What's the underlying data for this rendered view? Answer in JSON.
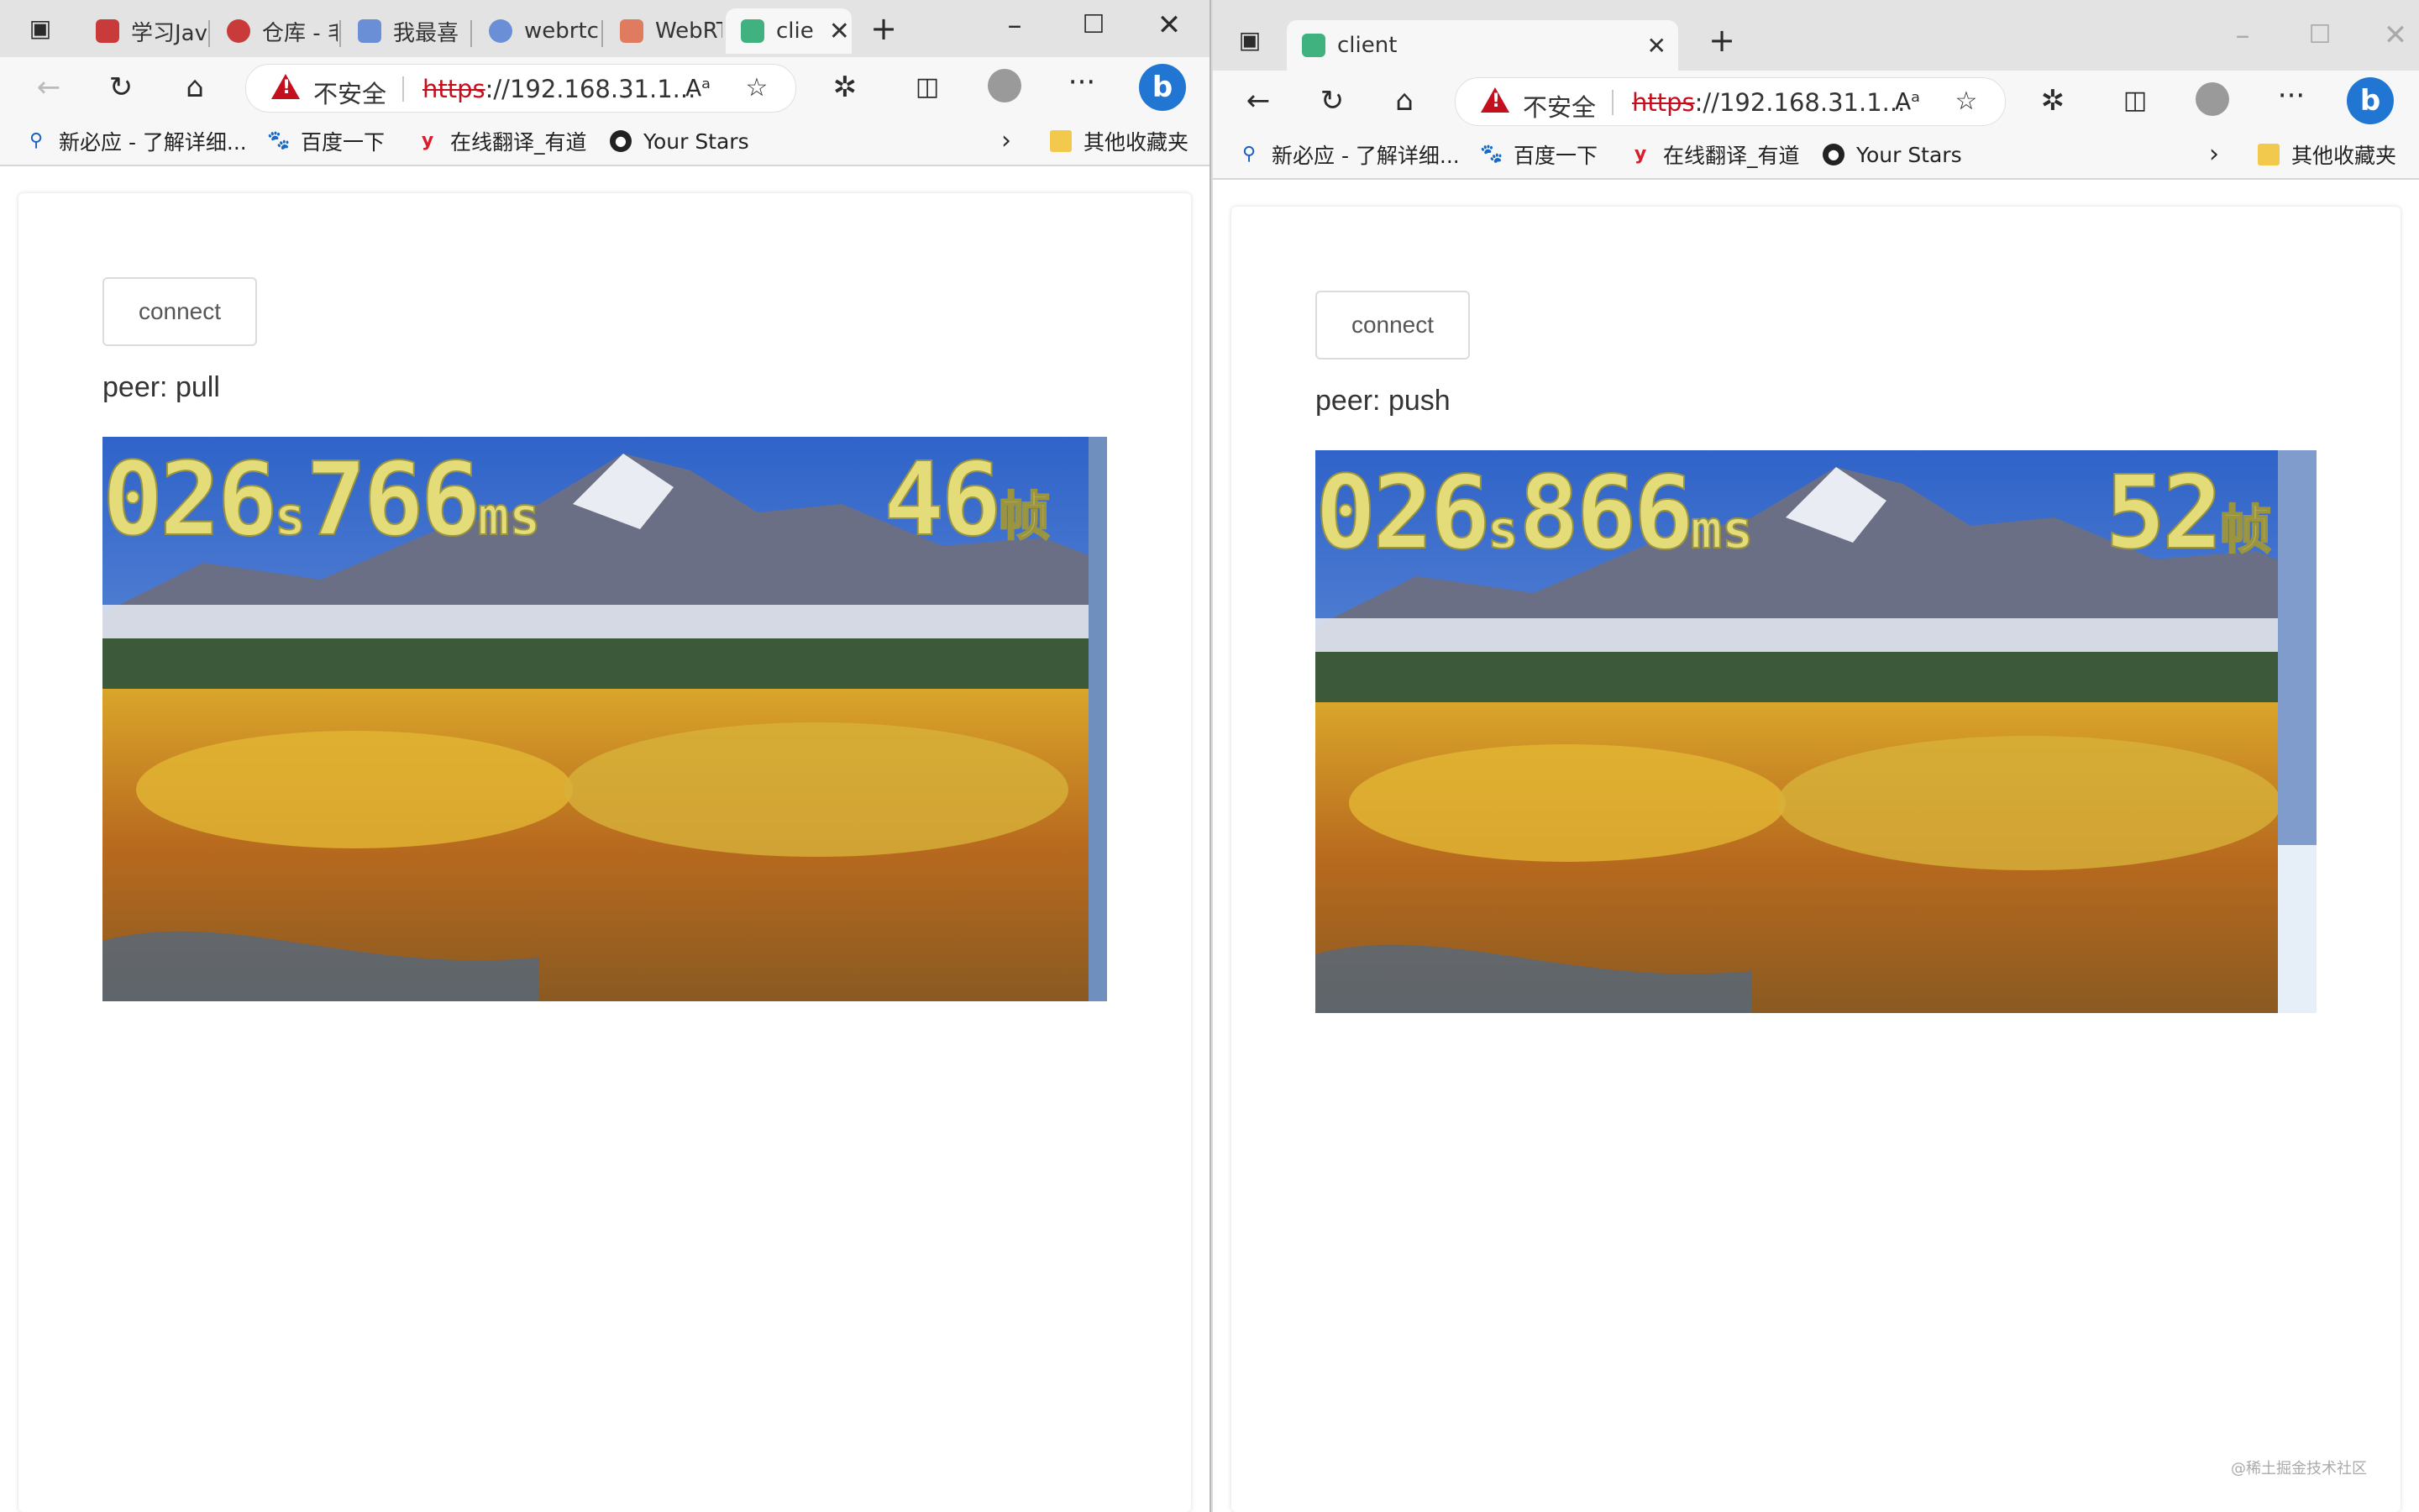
{
  "left_window": {
    "tabs": [
      {
        "label": "学习Jav",
        "color": "#c93b3b"
      },
      {
        "label": "仓库 - 毛",
        "color": "#c93b3b"
      },
      {
        "label": "我最喜",
        "color": "#6b8fd6"
      },
      {
        "label": "webrtc",
        "color": "#6b8fd6"
      },
      {
        "label": "WebRTC",
        "color": "#e07b5f"
      },
      {
        "label": "clie",
        "color": "#3fb27f",
        "active": true
      }
    ],
    "address": {
      "insecure_label": "不安全",
      "scheme": "https",
      "url_rest": "://192.168.31.1..."
    },
    "bookmarks": [
      {
        "label": "新必应 - 了解详细...",
        "icon": "search-icon"
      },
      {
        "label": "百度一下",
        "icon": "baidu-icon"
      },
      {
        "label": "在线翻译_有道",
        "icon": "youdao-icon"
      },
      {
        "label": "Your Stars",
        "icon": "github-icon"
      }
    ],
    "other_bookmarks": "其他收藏夹",
    "page": {
      "connect_label": "connect",
      "peer_label": "peer: pull",
      "overlay": {
        "seconds": "026",
        "s_unit": "s",
        "ms": "766",
        "ms_unit": "ms",
        "frames": "46",
        "frames_unit": "帧"
      }
    }
  },
  "right_window": {
    "tab": {
      "label": "client",
      "color": "#3fb27f"
    },
    "address": {
      "insecure_label": "不安全",
      "scheme": "https",
      "url_rest": "://192.168.31.1..."
    },
    "bookmarks": [
      {
        "label": "新必应 - 了解详细...",
        "icon": "search-icon"
      },
      {
        "label": "百度一下",
        "icon": "baidu-icon"
      },
      {
        "label": "在线翻译_有道",
        "icon": "youdao-icon"
      },
      {
        "label": "Your Stars",
        "icon": "github-icon"
      }
    ],
    "other_bookmarks": "其他收藏夹",
    "page": {
      "connect_label": "connect",
      "peer_label": "peer: push",
      "overlay": {
        "seconds": "026",
        "s_unit": "s",
        "ms": "866",
        "ms_unit": "ms",
        "frames": "52",
        "frames_unit": "帧"
      }
    },
    "watermark": "@稀土掘金技术社区"
  }
}
